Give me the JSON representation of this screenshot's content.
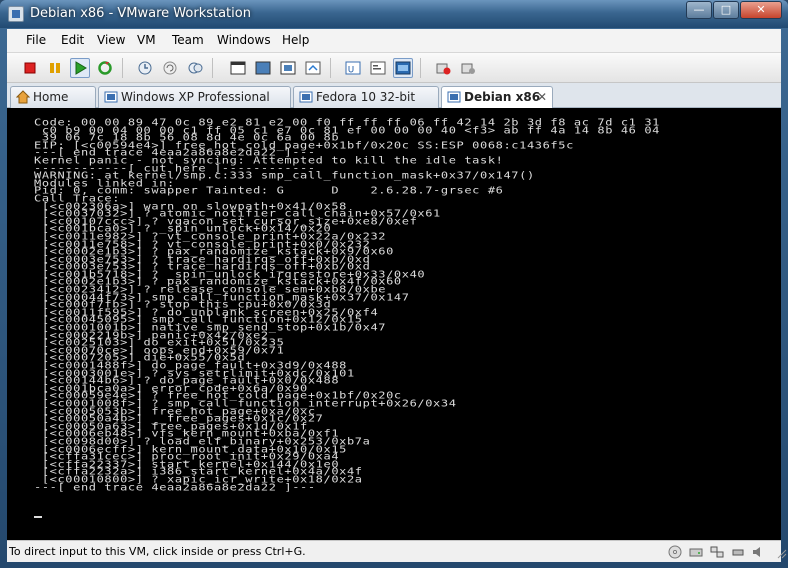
{
  "window": {
    "title": "Debian x86 - VMware Workstation"
  },
  "menu": [
    "File",
    "Edit",
    "View",
    "VM",
    "Team",
    "Windows",
    "Help"
  ],
  "toolbar": {
    "icons": [
      "power-off-icon",
      "suspend-icon",
      "power-on-icon",
      "reset-icon",
      "snapshot-icon",
      "revert-snapshot-icon",
      "snapshot-manager-icon",
      "normal-view-icon",
      "full-screen-icon",
      "quick-switch-icon",
      "fit-window-icon",
      "unity-icon",
      "console-view-icon",
      "summary-view-icon",
      "vm-settings-icon",
      "team-settings-icon"
    ]
  },
  "tabs": [
    {
      "label": "Home",
      "active": false
    },
    {
      "label": "Windows XP Professional",
      "active": false
    },
    {
      "label": "Fedora 10 32-bit",
      "active": false
    },
    {
      "label": "Debian x86",
      "active": true
    }
  ],
  "console": {
    "lines": [
      "Code: 00 00 89 47 0c 89 e2 81 e2 00 f0 ff ff ff 06 ff 42 14 2b 3d f8 ac 7d c1 31",
      " c0 b9 00 04 00 00 c1 ff 05 c1 e7 0c 81 ef 00 00 00 40 <f3> ab ff 4a 14 8b 46 04",
      " 39 06 7c 18 8b 56 08 8d 4e 0c 6a 00 8b",
      "EIP: [<c00594e4>] free_hot_cold_page+0x1bf/0x20c SS:ESP 0068:c1436f5c",
      "---[ end trace 4eaa2a86a8e2da22 ]---",
      "Kernel panic - not syncing: Attempted to kill the idle task!",
      "------------[ cut here ]------------",
      "WARNING: at kernel/smp.c:333 smp_call_function_mask+0x37/0x147()",
      "Modules linked in:",
      "Pid: 0, comm: swapper Tainted: G      D    2.6.28.7-grsec #6",
      "Call Trace:",
      " [<c002306a>] warn_on_slowpath+0x41/0x58",
      " [<c0037032>] ? atomic_notifier_call_chain+0x57/0x61",
      " [<c00107ccc>] ? vgacon_set_cursor_size+0xe8/0xef",
      " [<c001bca0>] ? _spin_unlock+0x14/0x20",
      " [<c0011e982>] ? vt_console_print+0x22a/0x232",
      " [<c0011e758>] ? vt_console_print+0x0/0x232",
      " [<c0002e1b3>] ? pax_randomize_kstack+0x9/0x60",
      " [<c0003e753>] ? trace_hardirqs_off+0xb/0xd",
      " [<c0003e753>] ? trace_hardirqs_off+0xb/0xd",
      " [<c001b5718>] ? _spin_unlock_irqrestore+0x33/0x40",
      " [<c0002e1b3>] ? pax_randomize_kstack+0x4f/0x60",
      " [<c0023412>] ? release_console_sem+0xb8/0xbe",
      " [<c00044f73>] smp_call_function_mask+0x37/0x147",
      " [<c000f7fb>] ? stop_this_cpu+0x0/0x3d",
      " [<c0011f595>] ? do_unblank_screen+0x25/0xf4",
      " [<c00045095>] smp_call_function+0x12/0x15",
      " [<c0001001b>] native_smp_send_stop+0x1b/0x47",
      " [<c0002219b>] panic+0x42/0xe2",
      " [<c0025103>] do_exit+0x51/0x235",
      " [<c00070ce>] oops_end+0x59/0x71",
      " [<c0007205>] die+0x55/0x5d",
      " [<c0001488f>] do_page_fault+0x3d9/0x488",
      " [<c0003001e>] ? sys_setrlimit+0xdc/0x101",
      " [<c00144b6>] ? do_page_fault+0x0/0x488",
      " [<c001bca0a>] error_code+0x6a/0x90",
      " [<c00059e4e>] ? free_hot_cold_page+0x1bf/0x20c",
      " [<c0001008f>] ? smp_call_function_interrupt+0x26/0x34",
      " [<c0005053b>] free_hot_page+0xa/0xc",
      " [<c00050a4b>] __free_pages+0x1c/0x27",
      " [<c00050a63>] free_pages+0x1d/0x1f",
      " [<c0006eb48>] vfs_kern_mount+0xba/0xf1",
      " [<c0098d00>] ? load_elf_binary+0x253/0xb7a",
      " [<c0006ecff>] kern_mount_data+0x10/0x15",
      " [<cffa31cec>] proc_root_init+0x29/0xa4",
      " [<cffa22337>] start_kernel+0x144/0x1e0",
      " [<cffa2232a>] i386_start_kernel+0x4a/0x4f",
      " [<c00010800>] ? xapic_icr_write+0x18/0x2a",
      "---[ end trace 4eaa2a86a8e2da22 ]---"
    ]
  },
  "status": {
    "text": "To direct input to this VM, click inside or press Ctrl+G."
  },
  "colors": {
    "console_bg": "#000000",
    "console_fg": "#dcdcdc",
    "titlebar": "#3a6690"
  }
}
